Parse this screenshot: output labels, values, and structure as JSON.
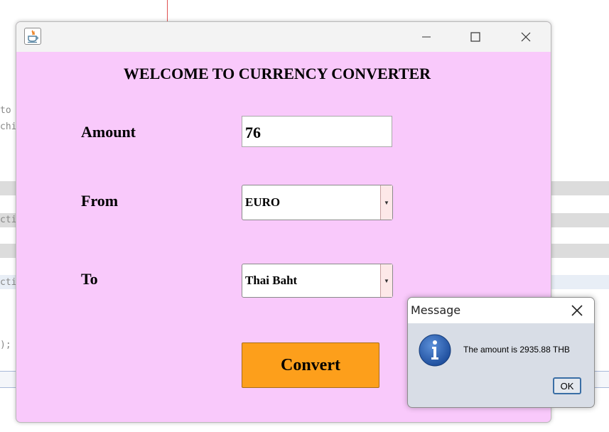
{
  "window": {
    "icon": "java-icon",
    "heading": "WELCOME TO CURRENCY CONVERTER",
    "amount_label": "Amount",
    "amount_value": "76",
    "from_label": "From",
    "from_selected": "EURO",
    "to_label": "To",
    "to_selected": "Thai Baht",
    "convert_label": "Convert",
    "background_color": "#f9c9fb",
    "button_color": "#fd9f1b"
  },
  "dialog": {
    "title": "Message",
    "icon": "info-icon",
    "message": "The amount is 2935.88 THB",
    "ok_label": "OK"
  },
  "background_code": {
    "line1": "to",
    "line2": "chi",
    "line3": "cti",
    "line4": "cti",
    "line5": ");"
  }
}
